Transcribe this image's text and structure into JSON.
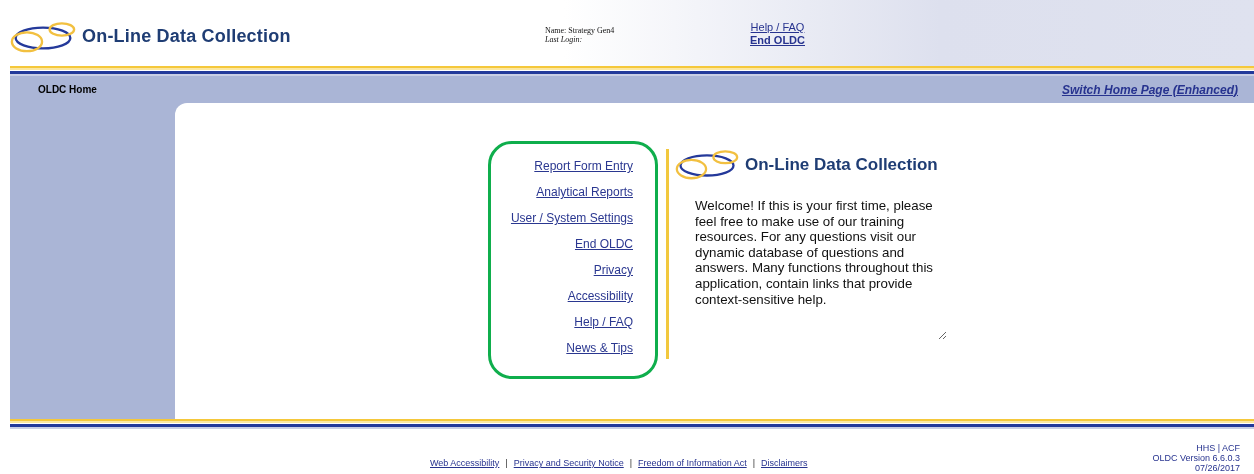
{
  "header": {
    "app_title": "On-Line Data Collection",
    "user_name": "Name: Strategy Gen4",
    "last_login": "Last Login:",
    "links": [
      "Help / FAQ",
      "End OLDC"
    ]
  },
  "nav_bar": {
    "title": "OLDC Home",
    "link": "Switch Home Page (Enhanced)"
  },
  "menu_links": [
    "Report Form Entry",
    "Analytical Reports",
    "User / System Settings",
    "End OLDC",
    "Privacy",
    "Accessibility",
    "Help / FAQ",
    "News & Tips"
  ],
  "welcome_panel": {
    "title": "On-Line Data Collection",
    "message": "Welcome! If this is your first time, please feel free to make use of our training resources. For any questions visit our dynamic database of questions and answers. Many functions throughout this application, contain links that provide context-sensitive help."
  },
  "footer": {
    "links": [
      "Web Accessibility",
      "Privacy and Security Notice",
      "Freedom of Information Act",
      "Disclaimers"
    ],
    "separator": "|",
    "agency": "HHS | ACF",
    "version": "OLDC Version 6.6.0.3",
    "date": "07/26/2017"
  }
}
